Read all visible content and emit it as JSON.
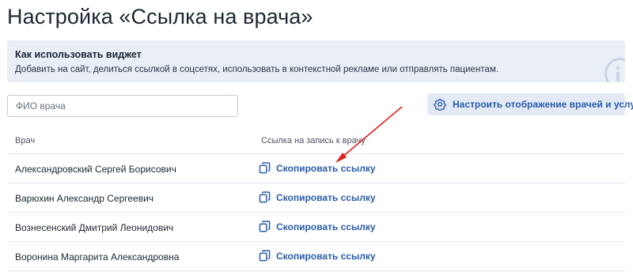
{
  "page": {
    "title": "Настройка «Ссылка на врача»"
  },
  "info": {
    "title": "Как использовать виджет",
    "text": "Добавить на сайт, делиться ссылкой в соцсетях, использовать в контекстной рекламе или отправлять пациентам.",
    "icon": "info-icon"
  },
  "search": {
    "placeholder": "ФИО врача",
    "value": ""
  },
  "settings_button": {
    "label": "Настроить отображение врачей и услуг",
    "icon": "gear-icon"
  },
  "table": {
    "headers": {
      "doctor": "Врач",
      "link": "Ссылка на запись к врачу"
    },
    "rows": [
      {
        "doctor": "Александровский Сергей Борисович",
        "link_label": "Скопировать ссылку"
      },
      {
        "doctor": "Варюхин Александр Сергеевич",
        "link_label": "Скопировать ссылку"
      },
      {
        "doctor": "Вознесенский Дмитрий Леонидович",
        "link_label": "Скопировать ссылку"
      },
      {
        "doctor": "Воронина Маргарита Александровна",
        "link_label": "Скопировать ссылку"
      }
    ],
    "link_icon": "copy-icon"
  },
  "colors": {
    "accent": "#2a5caa",
    "info_bg": "#e9eef7",
    "button_bg": "#e3eaf6",
    "annotation_arrow": "#e02020"
  }
}
